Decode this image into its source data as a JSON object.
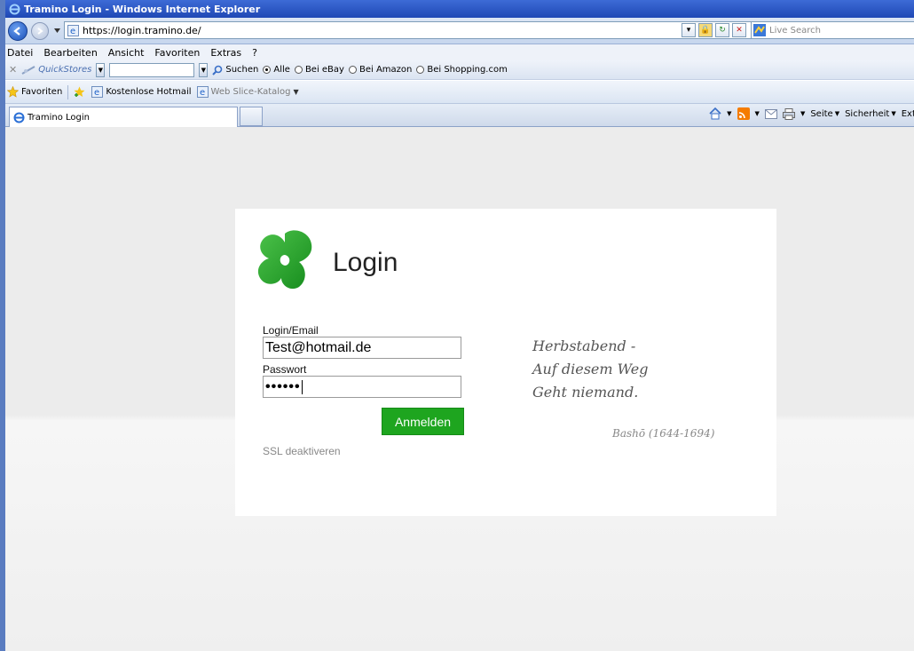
{
  "window": {
    "title": "Tramino Login - Windows Internet Explorer"
  },
  "addressbar": {
    "url": "https://login.tramino.de/",
    "search_placeholder": "Live Search"
  },
  "menubar": {
    "items": [
      "Datei",
      "Bearbeiten",
      "Ansicht",
      "Favoriten",
      "Extras",
      "?"
    ]
  },
  "quickstores": {
    "brand": "QuickStores",
    "search_label": "Suchen",
    "options": [
      "Alle",
      "Bei eBay",
      "Bei Amazon",
      "Bei Shopping.com"
    ]
  },
  "favbar": {
    "favorites_label": "Favoriten",
    "link1": "Kostenlose Hotmail",
    "link2": "Web Slice-Katalog"
  },
  "tabs": {
    "active_tab": "Tramino Login"
  },
  "commandbar": {
    "page": "Seite",
    "security": "Sicherheit",
    "extras": "Extr"
  },
  "login": {
    "title": "Login",
    "email_label": "Login/Email",
    "email_value": "Test@hotmail.de",
    "password_label": "Passwort",
    "password_value": "••••••",
    "submit": "Anmelden",
    "ssl_link": "SSL deaktiveren"
  },
  "poem": {
    "line1": "Herbstabend -",
    "line2": "Auf diesem Weg",
    "line3": "Geht niemand.",
    "author": "Bashō (1644-1694)"
  },
  "colors": {
    "accent_green": "#1ea51f",
    "titlebar_blue": "#1f48b5"
  }
}
